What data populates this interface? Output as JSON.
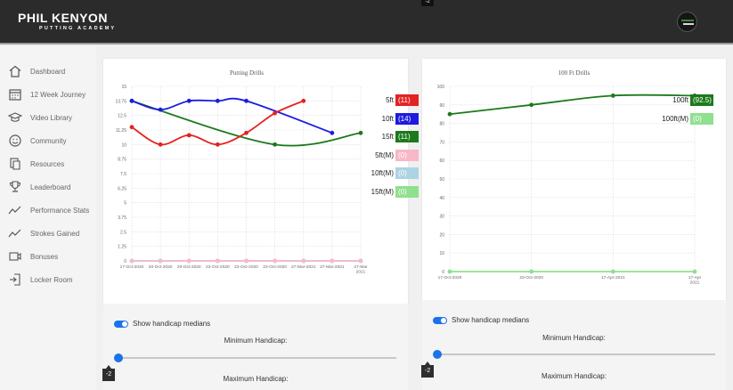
{
  "header": {
    "logo_main": "PHIL KENYON",
    "logo_sub": "PUTTING ACADEMY",
    "top_badge": "-2"
  },
  "sidebar": {
    "items": [
      {
        "label": "Dashboard",
        "icon": "home-icon"
      },
      {
        "label": "12 Week Journey",
        "icon": "calendar-icon"
      },
      {
        "label": "Video Library",
        "icon": "graduation-cap-icon"
      },
      {
        "label": "Community",
        "icon": "smiley-icon"
      },
      {
        "label": "Resources",
        "icon": "documents-icon"
      },
      {
        "label": "Leaderboard",
        "icon": "trophy-icon"
      },
      {
        "label": "Performance Stats",
        "icon": "trend-icon"
      },
      {
        "label": "Strokes Gained",
        "icon": "trend-icon"
      },
      {
        "label": "Bonuses",
        "icon": "video-icon"
      },
      {
        "label": "Locker Room",
        "icon": "logout-icon"
      }
    ]
  },
  "colors": {
    "red": "#e32222",
    "blue": "#1c1ce0",
    "green": "#1b7a1b",
    "pink": "#f8b8c8",
    "lightblue": "#acd4e3",
    "lightgreen": "#8fe08f",
    "accent": "#1a73e8"
  },
  "chart_data": [
    {
      "type": "line",
      "title": "Putting Drills",
      "x": [
        "17-Oct-2020",
        "20-Oct-2020",
        "20-Oct-2020",
        "22-Oct-2020",
        "22-Oct-2020",
        "22-Oct-2020",
        "27-Mar-2021",
        "27-Mar-2021",
        "27-Mar-2021"
      ],
      "ylim": [
        0,
        15
      ],
      "yticks": [
        "15",
        "13.75",
        "12.5",
        "11.25",
        "10",
        "8.75",
        "7.5",
        "6.25",
        "5",
        "3.75",
        "2.5",
        "1.25",
        "0"
      ],
      "grid": true,
      "legend_position": "right",
      "series": [
        {
          "name": "5ft",
          "value_label": "(11)",
          "color": "#e32222",
          "values": [
            11.5,
            10,
            10.8,
            10,
            11,
            12.7,
            13.75,
            null,
            null
          ]
        },
        {
          "name": "10ft",
          "value_label": "(14)",
          "color": "#1c1ce0",
          "values": [
            13.75,
            13,
            13.75,
            13.75,
            13.75,
            null,
            null,
            11,
            null
          ]
        },
        {
          "name": "15ft",
          "value_label": "(11)",
          "color": "#1b7a1b",
          "values": [
            13.75,
            null,
            null,
            null,
            null,
            10,
            null,
            null,
            11
          ]
        },
        {
          "name": "5ft(M)",
          "value_label": "(0)",
          "color": "#f8b8c8",
          "values": [
            0,
            0,
            0,
            0,
            0,
            0,
            0,
            0,
            0
          ]
        },
        {
          "name": "10ft(M)",
          "value_label": "(0)",
          "color": "#acd4e3",
          "values": [
            0,
            0,
            0,
            0,
            0,
            0,
            0,
            0,
            0
          ]
        },
        {
          "name": "15ft(M)",
          "value_label": "(0)",
          "color": "#8fe08f",
          "values": [
            0,
            0,
            0,
            0,
            0,
            0,
            0,
            0,
            0
          ]
        }
      ]
    },
    {
      "type": "line",
      "title": "100 Ft Drills",
      "x": [
        "17-Oct-2020",
        "23-Oct-2020",
        "17-Apr-2021",
        "17-Apr-2021"
      ],
      "ylim": [
        0,
        100
      ],
      "yticks": [
        "100",
        "90",
        "80",
        "70",
        "60",
        "50",
        "40",
        "30",
        "20",
        "10",
        "0"
      ],
      "grid": true,
      "legend_position": "right",
      "series": [
        {
          "name": "100ft",
          "value_label": "(92.5)",
          "color": "#1b7a1b",
          "values": [
            85,
            90,
            95,
            95
          ]
        },
        {
          "name": "100ft(M)",
          "value_label": "(0)",
          "color": "#8fe08f",
          "values": [
            0,
            0,
            0,
            0
          ]
        }
      ]
    }
  ],
  "controls": {
    "show_medians_label": "Show handicap medians",
    "min_label": "Minimum Handicap:",
    "max_label": "Maximum Handicap:",
    "min_value": "-2"
  }
}
